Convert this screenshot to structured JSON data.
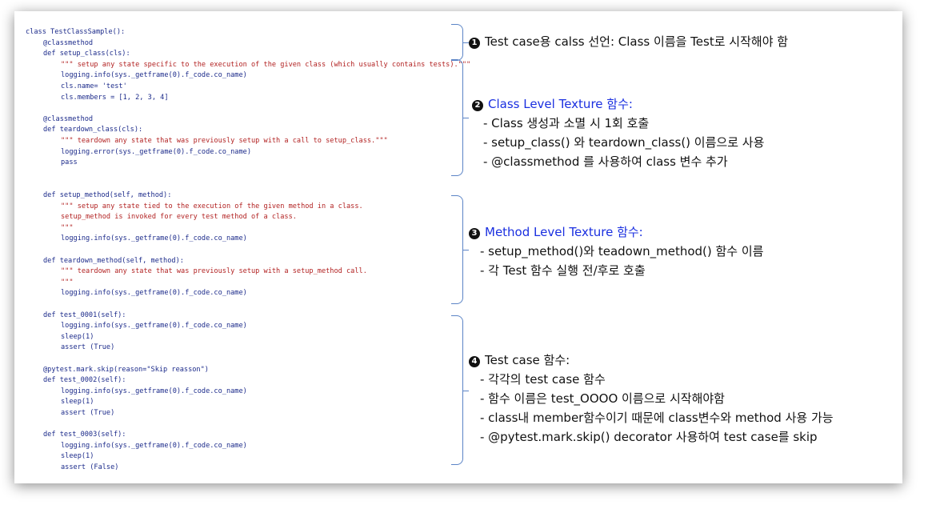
{
  "code_lines": [
    {
      "text": "class TestClassSample():",
      "cls": "c-plain",
      "indent": 0
    },
    {
      "text": "@classmethod",
      "cls": "c-deco",
      "indent": 1
    },
    {
      "text": "def setup_class(cls):",
      "cls": "c-plain",
      "indent": 1
    },
    {
      "text": "\"\"\" setup any state specific to the execution of the given class (which usually contains tests).\"\"\"",
      "cls": "c-str",
      "indent": 2
    },
    {
      "text": "logging.info(sys._getframe(0).f_code.co_name)",
      "cls": "c-plain",
      "indent": 2
    },
    {
      "text": "cls.name= 'test'",
      "cls": "c-plain",
      "indent": 2
    },
    {
      "text": "cls.members = [1, 2, 3, 4]",
      "cls": "c-plain",
      "indent": 2
    },
    {
      "text": "",
      "cls": "c-plain",
      "indent": 0
    },
    {
      "text": "@classmethod",
      "cls": "c-deco",
      "indent": 1
    },
    {
      "text": "def teardown_class(cls):",
      "cls": "c-plain",
      "indent": 1
    },
    {
      "text": "\"\"\" teardown any state that was previously setup with a call to setup_class.\"\"\"",
      "cls": "c-str",
      "indent": 2
    },
    {
      "text": "logging.error(sys._getframe(0).f_code.co_name)",
      "cls": "c-plain",
      "indent": 2
    },
    {
      "text": "pass",
      "cls": "c-plain",
      "indent": 2
    },
    {
      "text": "",
      "cls": "c-plain",
      "indent": 0
    },
    {
      "text": "",
      "cls": "c-plain",
      "indent": 0
    },
    {
      "text": "def setup_method(self, method):",
      "cls": "c-plain",
      "indent": 1
    },
    {
      "text": "\"\"\" setup any state tied to the execution of the given method in a class.",
      "cls": "c-str",
      "indent": 2
    },
    {
      "text": "setup_method is invoked for every test method of a class.",
      "cls": "c-str",
      "indent": 2
    },
    {
      "text": "\"\"\"",
      "cls": "c-str",
      "indent": 2
    },
    {
      "text": "logging.info(sys._getframe(0).f_code.co_name)",
      "cls": "c-plain",
      "indent": 2
    },
    {
      "text": "",
      "cls": "c-plain",
      "indent": 0
    },
    {
      "text": "def teardown_method(self, method):",
      "cls": "c-plain",
      "indent": 1
    },
    {
      "text": "\"\"\" teardown any state that was previously setup with a setup_method call.",
      "cls": "c-str",
      "indent": 2
    },
    {
      "text": "\"\"\"",
      "cls": "c-str",
      "indent": 2
    },
    {
      "text": "logging.info(sys._getframe(0).f_code.co_name)",
      "cls": "c-plain",
      "indent": 2
    },
    {
      "text": "",
      "cls": "c-plain",
      "indent": 0
    },
    {
      "text": "def test_0001(self):",
      "cls": "c-plain",
      "indent": 1
    },
    {
      "text": "logging.info(sys._getframe(0).f_code.co_name)",
      "cls": "c-plain",
      "indent": 2
    },
    {
      "text": "sleep(1)",
      "cls": "c-plain",
      "indent": 2
    },
    {
      "text": "assert (True)",
      "cls": "c-plain",
      "indent": 2
    },
    {
      "text": "",
      "cls": "c-plain",
      "indent": 0
    },
    {
      "text": "@pytest.mark.skip(reason=\"Skip reasson\")",
      "cls": "c-plain",
      "indent": 1
    },
    {
      "text": "def test_0002(self):",
      "cls": "c-plain",
      "indent": 1
    },
    {
      "text": "logging.info(sys._getframe(0).f_code.co_name)",
      "cls": "c-plain",
      "indent": 2
    },
    {
      "text": "sleep(1)",
      "cls": "c-plain",
      "indent": 2
    },
    {
      "text": "assert (True)",
      "cls": "c-plain",
      "indent": 2
    },
    {
      "text": "",
      "cls": "c-plain",
      "indent": 0
    },
    {
      "text": "def test_0003(self):",
      "cls": "c-plain",
      "indent": 1
    },
    {
      "text": "logging.info(sys._getframe(0).f_code.co_name)",
      "cls": "c-plain",
      "indent": 2
    },
    {
      "text": "sleep(1)",
      "cls": "c-plain",
      "indent": 2
    },
    {
      "text": "assert (False)",
      "cls": "c-plain",
      "indent": 2
    }
  ],
  "notes": {
    "n1": {
      "num": "1",
      "title": "Test case용 calss 선언: Class 이름을 Test로 시작해야 함"
    },
    "n2": {
      "num": "2",
      "title": "Class Level Texture 함수:",
      "items": [
        "- Class 생성과 소멸 시 1회 호출",
        "- setup_class() 와 teardown_class() 이름으로 사용",
        "- @classmethod 를 사용하여 class 변수 추가"
      ]
    },
    "n3": {
      "num": "3",
      "title": "Method Level Texture 함수:",
      "items": [
        "- setup_method()와 teadown_method() 함수 이름",
        "- 각 Test 함수 실행 전/후로 호출"
      ]
    },
    "n4": {
      "num": "4",
      "title": "Test case 함수:",
      "items": [
        "- 각각의 test  case 함수",
        "- 함수 이름은 test_OOOO 이름으로 시작해야함",
        "- class내 member함수이기 때문에 class변수와 method 사용 가능",
        "- @pytest.mark.skip() decorator 사용하여 test case를 skip"
      ]
    }
  },
  "colors": {
    "code_text": "#1b2a8a",
    "code_string": "#b22222",
    "note_highlight": "#1a2fe0",
    "brace": "#5b84c6"
  }
}
